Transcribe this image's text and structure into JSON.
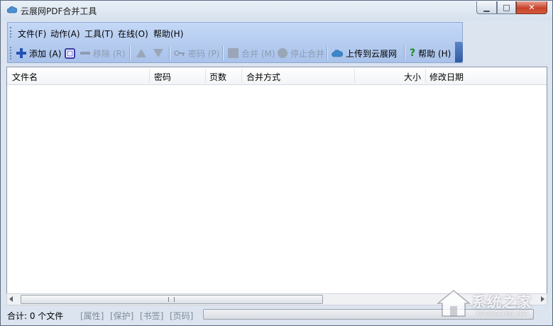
{
  "window": {
    "title": "云展网PDF合并工具",
    "controls": {
      "minimize": "▁",
      "maximize": "□",
      "close": "✕"
    }
  },
  "menu": [
    {
      "label": "文件(F)"
    },
    {
      "label": "动作(A)"
    },
    {
      "label": "工具(T)"
    },
    {
      "label": "在线(O)"
    },
    {
      "label": "帮助(H)"
    }
  ],
  "toolbar": {
    "add": "添加 (A)",
    "remove": "移除 (R)",
    "password": "密码 (P)",
    "merge": "合并 (M)",
    "stop_merge": "停止合并",
    "upload": "上传到云展网",
    "help": "帮助 (H)"
  },
  "table": {
    "columns": [
      "文件名",
      "密码",
      "页数",
      "合并方式",
      "大小",
      "修改日期"
    ],
    "rows": []
  },
  "status": {
    "total": "合计: 0 个文件",
    "tags": [
      "[属性]",
      "[保护]",
      "[书签]",
      "[页码]"
    ]
  },
  "watermark": {
    "text": "系统之家",
    "url": "XITONGZHIJIA.NET"
  },
  "colors": {
    "toolbar_bg": "#b6cdf1",
    "disabled_text": "#8d9bb0",
    "add_icon": "#2453b5",
    "help_icon": "#1f8a1f",
    "upload_icon": "#3c86c9"
  }
}
